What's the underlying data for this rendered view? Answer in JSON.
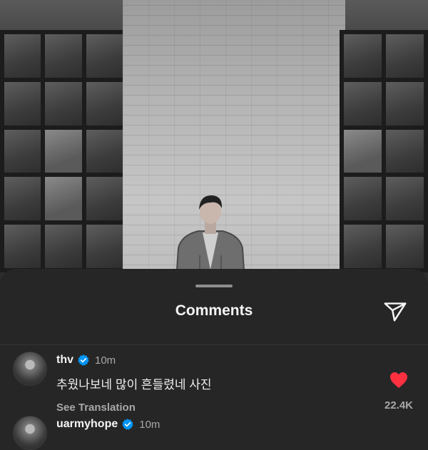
{
  "sheet": {
    "title": "Comments"
  },
  "colors": {
    "sheet_background": "#262626",
    "verified_badge": "#0095f6",
    "like_heart": "#ff3040",
    "secondary_text": "#a8a8a8"
  },
  "icons": {
    "send": "paper-plane-icon",
    "verified": "verified-badge-icon",
    "like": "heart-icon"
  },
  "comments": [
    {
      "username": "thv",
      "verified": true,
      "time": "10m",
      "text": "추웠나보네 많이 흔들렸네 사진",
      "translate_label": "See Translation",
      "liked": true,
      "like_count": "22.4K"
    },
    {
      "username": "uarmyhope",
      "verified": true,
      "time": "10m"
    }
  ]
}
